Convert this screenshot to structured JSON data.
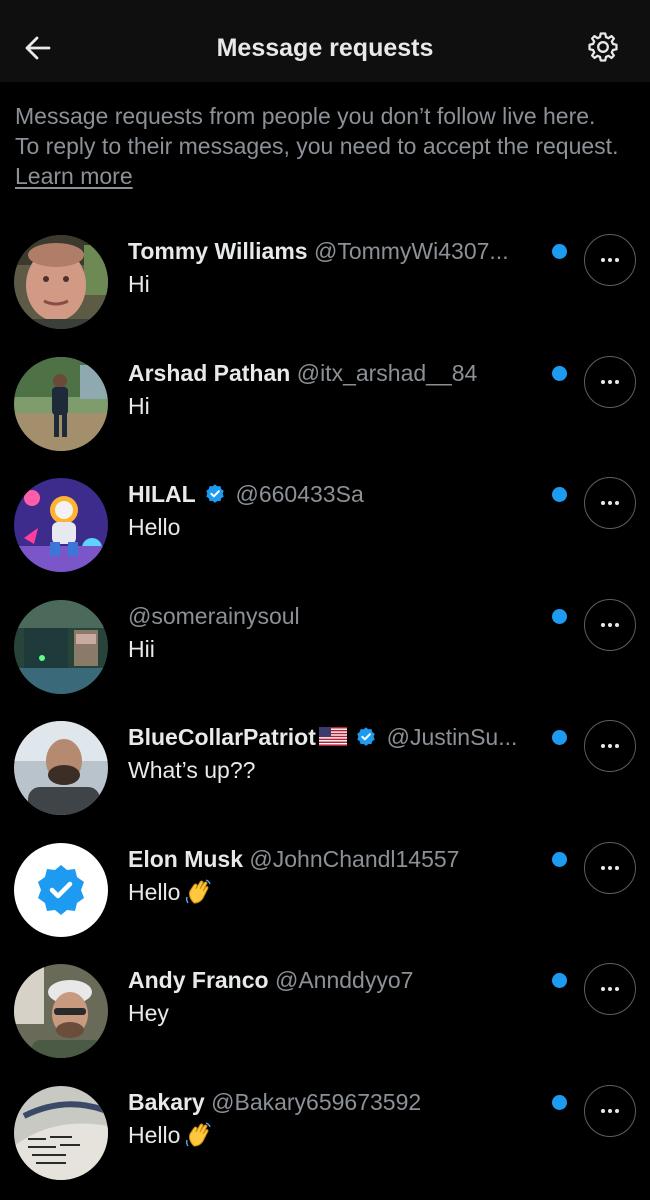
{
  "header": {
    "title": "Message requests",
    "back_icon": "arrow-left-icon",
    "settings_icon": "gear-icon"
  },
  "intro": {
    "text": "Message requests from people you don’t follow live here. To reply to their messages, you need to accept the request.",
    "link": "Learn more"
  },
  "colors": {
    "unread_dot": "#1d9bf0",
    "verified_badge": "#1d9bf0",
    "secondary_text": "#8b9196"
  },
  "requests": [
    {
      "name": "Tommy Williams",
      "handle": "@TommyWi4307...",
      "message": "Hi",
      "verified": false,
      "flag": false,
      "wave": false,
      "unread": true
    },
    {
      "name": "Arshad Pathan",
      "handle": "@itx_arshad__84",
      "message": "Hi",
      "verified": false,
      "flag": false,
      "wave": false,
      "unread": true
    },
    {
      "name": "HILAL",
      "handle": "@660433Sa",
      "message": "Hello",
      "verified": true,
      "flag": false,
      "wave": false,
      "unread": true
    },
    {
      "name": "",
      "handle": "@somerainysoul",
      "message": "Hii",
      "verified": false,
      "flag": false,
      "wave": false,
      "unread": true
    },
    {
      "name": "BlueCollarPatriot",
      "handle": "@JustinSu...",
      "message": "What’s up??",
      "verified": true,
      "flag": true,
      "wave": false,
      "unread": true
    },
    {
      "name": "Elon Musk",
      "handle": "@JohnChandl14557",
      "message": "Hello",
      "verified": false,
      "flag": false,
      "wave": true,
      "unread": true
    },
    {
      "name": "Andy Franco",
      "handle": "@Annddyyo7",
      "message": "Hey",
      "verified": false,
      "flag": false,
      "wave": false,
      "unread": true
    },
    {
      "name": "Bakary",
      "handle": "@Bakary659673592",
      "message": "Hello",
      "verified": false,
      "flag": false,
      "wave": true,
      "unread": true
    }
  ]
}
